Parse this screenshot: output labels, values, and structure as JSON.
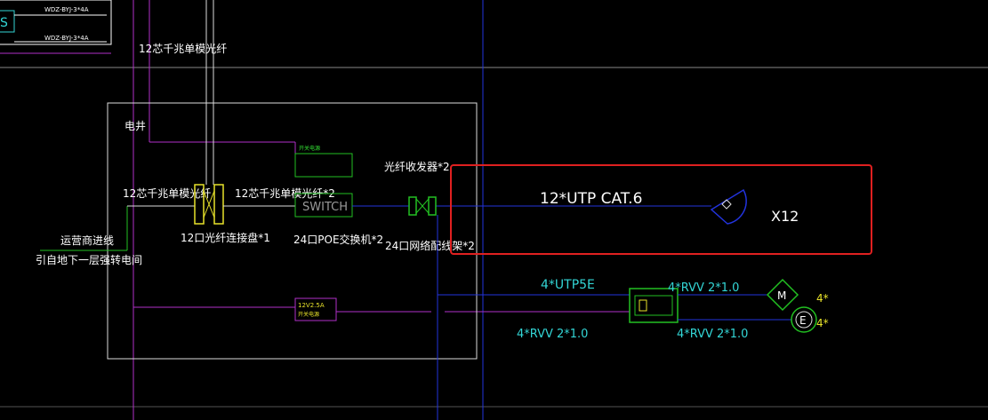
{
  "top_left": {
    "box_label": "S",
    "circuit_1": "WDZ-BYJ-3*4A",
    "circuit_2": "WDZ-BYJ-3*4A"
  },
  "labels": {
    "fiber_top": "12芯千兆单模光纤",
    "shaft": "电井",
    "fiber_in": "12芯千兆单模光纤",
    "fiber_out": "12芯千兆单模光纤*2",
    "patch_panel": "12口光纤连接盘*1",
    "fiber_transceiver": "光纤收发器*2",
    "poe_switch": "24口POE交换机*2",
    "network_patch": "24口网络配线架*2",
    "carrier_line": "运营商进线",
    "carrier_route": "引自地下一层强转电间",
    "switch": "SWITCH",
    "psu_1": "12V2.5A",
    "psu_2": "开关电源",
    "upper_box_small": "开关电源"
  },
  "highlight": {
    "cable": "12*UTP  CAT.6",
    "count": "X12"
  },
  "lower": {
    "utp5e": "4*UTP5E",
    "rvv_1": "4*RVV 2*1.0",
    "rvv_2": "4*RVV 2*1.0",
    "rvv_3": "4*RVV 2*1.0",
    "m_symbol": "M",
    "e_symbol": "E",
    "qty_1": "4*",
    "qty_2": "4*"
  },
  "colors": {
    "background": "#000000",
    "highlight_frame": "#e02020",
    "cable_blue": "#2233dd",
    "riser_magenta": "#b030c8",
    "equipment_green": "#22c022",
    "text_cyan": "#33d6d6",
    "text_yellow": "#e8e22a"
  }
}
